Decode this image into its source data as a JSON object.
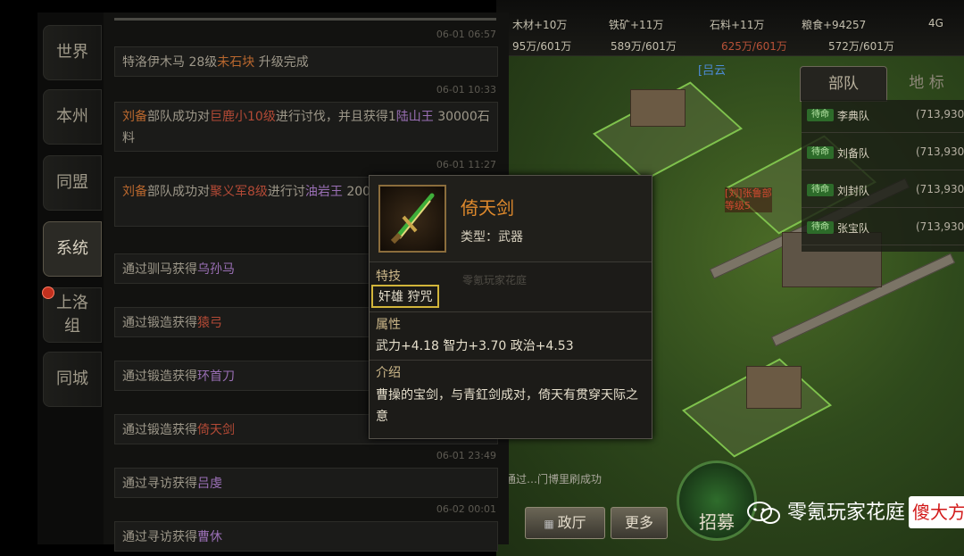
{
  "resources": {
    "top": [
      {
        "label": "木材+10万",
        "color": "#c4bfae"
      },
      {
        "label": "铁矿+11万",
        "color": "#c4bfae"
      },
      {
        "label": "石料+11万",
        "color": "#c4bfae"
      },
      {
        "label": "粮食+94257",
        "color": "#c4bfae"
      },
      {
        "label": "4G",
        "color": "#c4bfae"
      }
    ],
    "bottom": [
      {
        "label": "95万/601万",
        "color": "#c4bfae"
      },
      {
        "label": "589万/601万",
        "color": "#c4bfae"
      },
      {
        "label": "625万/601万",
        "color": "#b85238"
      },
      {
        "label": "572万/601万",
        "color": "#c4bfae"
      }
    ]
  },
  "map": {
    "player_tag": "[吕云",
    "enemy_label_line1": "[刘]张鲁部",
    "enemy_label_line2": "等级5"
  },
  "troop_panel": {
    "tabs": [
      "部队",
      "地 标"
    ],
    "rows": [
      {
        "badge": "待命",
        "name": "李典队",
        "coords": "(713,930"
      },
      {
        "badge": "待命",
        "name": "刘备队",
        "coords": "(713,930"
      },
      {
        "badge": "待命",
        "name": "刘封队",
        "coords": "(713,930"
      },
      {
        "badge": "待命",
        "name": "张宝队",
        "coords": "(713,930"
      }
    ]
  },
  "bottom_bar": {
    "marquee": "通过…门博里刷成功",
    "hall_button": "政厅",
    "more_button": "更多",
    "recruit_button": "招募"
  },
  "watermark": {
    "text": "零氪玩家花庭",
    "logo": "傻大方"
  },
  "sidebar": {
    "tabs": [
      {
        "label": "世界",
        "active": false,
        "dot": false
      },
      {
        "label": "本州",
        "active": false,
        "dot": false
      },
      {
        "label": "同盟",
        "active": false,
        "dot": false
      },
      {
        "label": "系统",
        "active": true,
        "dot": false
      },
      {
        "label": "上洛组",
        "active": false,
        "dot": true
      },
      {
        "label": "同城",
        "active": false,
        "dot": false
      }
    ]
  },
  "messages": {
    "timestamps": [
      "06-01 06:57",
      "06-01 10:33",
      "06-01 11:27",
      "06-01 23:49",
      "06-02 00:01"
    ],
    "items": [
      {
        "segments": [
          {
            "t": "特洛伊木马 28级"
          },
          {
            "t": "未石块",
            "c": "hl-o"
          },
          {
            "t": " 升级完成"
          }
        ]
      },
      {
        "segments": [
          {
            "t": "刘备",
            "c": "hl-o"
          },
          {
            "t": "部队成功对"
          },
          {
            "t": "巨鹿小10级",
            "c": "hl-r"
          },
          {
            "t": "进行讨伐，并且获得"
          },
          {
            "t": "1"
          },
          {
            "t": "陆山王",
            "c": "hl-p"
          },
          {
            "t": " 30000石料"
          }
        ]
      },
      {
        "segments": [
          {
            "t": "刘备",
            "c": "hl-o"
          },
          {
            "t": "部队成功对"
          },
          {
            "t": "聚义军8级",
            "c": "hl-r"
          },
          {
            "t": "进行讨"
          },
          {
            "t": "油岩王",
            "c": "hl-p"
          },
          {
            "t": " 20000石料"
          }
        ]
      },
      {
        "segments": [
          {
            "t": "通过驯马获得"
          },
          {
            "t": "乌孙马",
            "c": "hl-p"
          }
        ]
      },
      {
        "segments": [
          {
            "t": "通过锻造获得"
          },
          {
            "t": "猿弓",
            "c": "hl-r"
          }
        ]
      },
      {
        "segments": [
          {
            "t": "通过锻造获得"
          },
          {
            "t": "环首刀",
            "c": "hl-p"
          }
        ]
      },
      {
        "segments": [
          {
            "t": "通过锻造获得"
          },
          {
            "t": "倚天剑",
            "c": "hl-r"
          }
        ]
      },
      {
        "segments": [
          {
            "t": "通过寻访获得"
          },
          {
            "t": "吕虔",
            "c": "hl-p"
          }
        ]
      },
      {
        "segments": [
          {
            "t": "通过寻访获得"
          },
          {
            "t": "曹休",
            "c": "hl-p"
          }
        ]
      }
    ]
  },
  "tooltip": {
    "name": "倚天剑",
    "type": "类型：武器",
    "skill_title": "特技",
    "skill_value": "奸雄 狩咒",
    "ghost_text": "零氪玩家花庭",
    "attr_title": "属性",
    "attr_value": "武力+4.18 智力+3.70 政治+4.53",
    "intro_title": "介绍",
    "intro_value": "曹操的宝剑，与青釭剑成对，倚天有贯穿天际之意"
  }
}
